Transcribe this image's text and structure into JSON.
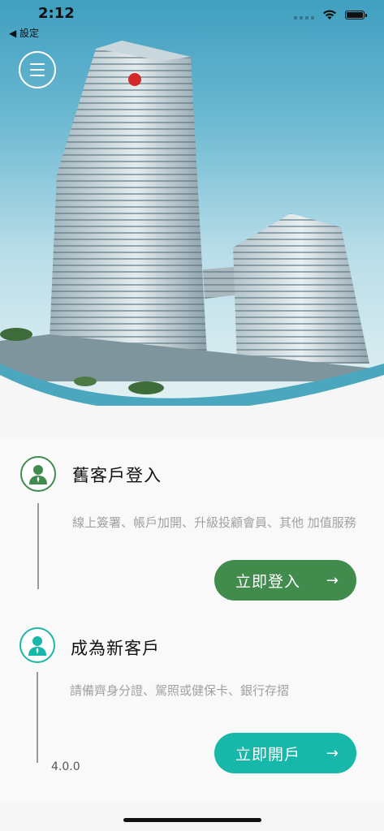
{
  "status_bar": {
    "time": "2:12",
    "back_label": "◀ 設定",
    "battery_level": 1.0
  },
  "menu": {
    "icon": "hamburger-menu-icon"
  },
  "existing_customer": {
    "icon": "user-avatar-icon",
    "title": "舊客戶登入",
    "description": "線上簽署、帳戶加開、升級投顧會員、其他 加值服務",
    "button_label": "立即登入",
    "button_arrow": "→",
    "accent": "#418c4d"
  },
  "new_customer": {
    "icon": "user-avatar-icon",
    "title": "成為新客戶",
    "description": "請備齊身分證、駕照或健保卡、銀行存摺",
    "button_label": "立即開戶",
    "button_arrow": "→",
    "accent": "#17b7a9"
  },
  "version": "4.0.0"
}
